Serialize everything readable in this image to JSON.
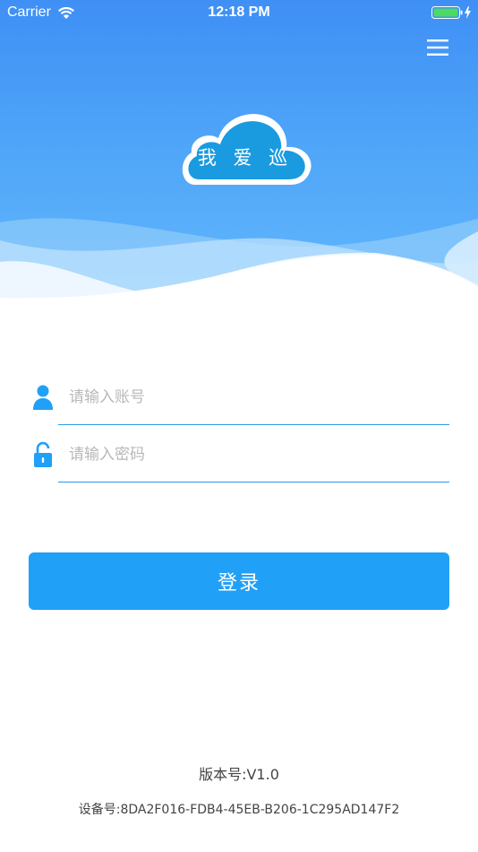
{
  "status_bar": {
    "carrier": "Carrier",
    "time": "12:18 PM",
    "battery_color": "#4cd964"
  },
  "header": {
    "menu_icon": "hamburger-menu-icon",
    "logo_text": "我 爱 巡",
    "logo_color": "#1a9be0"
  },
  "form": {
    "username_placeholder": "请输入账号",
    "password_placeholder": "请输入密码",
    "login_label": "登录",
    "accent_color": "#21a0f7"
  },
  "footer": {
    "version": "版本号:V1.0",
    "device_id": "设备号:8DA2F016-FDB4-45EB-B206-1C295AD147F2"
  }
}
